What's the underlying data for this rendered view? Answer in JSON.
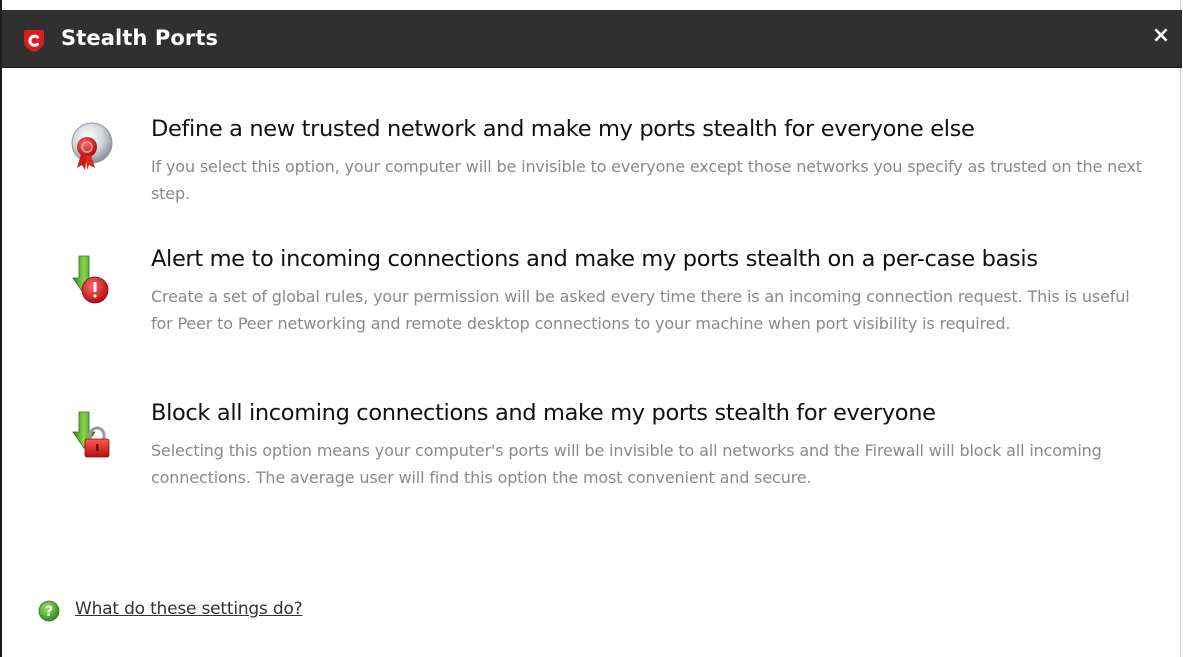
{
  "window": {
    "title": "Stealth Ports",
    "close_label": "×"
  },
  "options": [
    {
      "title": "Define a new trusted network and make my ports stealth for everyone else",
      "description": "If you select this option, your computer will be invisible to everyone except those networks you specify as trusted on the next step.",
      "icon": "trusted-network-icon"
    },
    {
      "title": "Alert me to incoming connections and make my ports stealth on a per-case basis",
      "description": "Create a set of global rules, your permission will be asked every time there is an incoming connection request. This is useful for Peer to Peer networking and remote desktop connections to your machine when port visibility is required.",
      "icon": "alert-connection-icon"
    },
    {
      "title": "Block all incoming connections and make my ports stealth for everyone",
      "description": "Selecting this option means your computer's ports will be invisible to all networks and the Firewall will block all incoming connections. The average user will find this option the most convenient and secure.",
      "icon": "block-connection-icon"
    }
  ],
  "help": {
    "link_text": "What do these settings do?",
    "icon": "help-icon"
  },
  "colors": {
    "titlebar": "#303030",
    "title_text": "#ffffff",
    "option_title": "#111111",
    "option_description": "#8a8a8a",
    "brand_red": "#d81e1e"
  }
}
